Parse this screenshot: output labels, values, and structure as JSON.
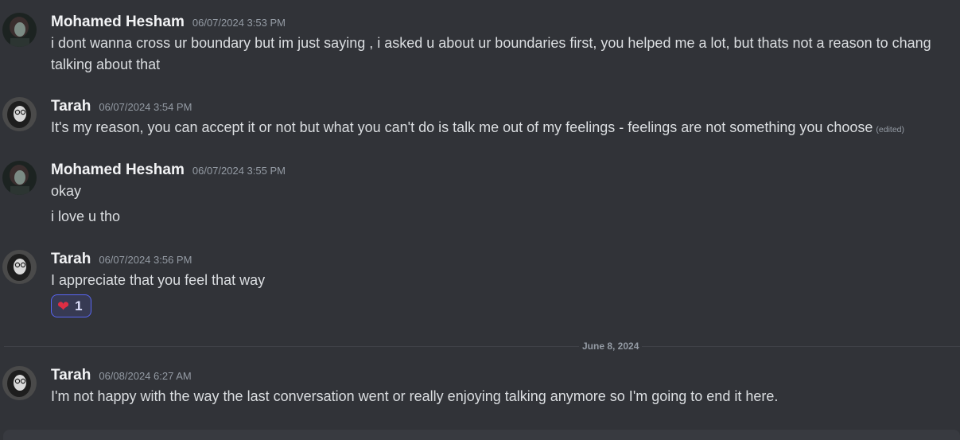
{
  "messages": [
    {
      "author": "Mohamed Hesham",
      "timestamp": "06/07/2024 3:53 PM",
      "lines": [
        "i dont wanna cross ur boundary but im just saying , i asked u about ur boundaries first, you helped me a lot, but thats not a reason to chang",
        "talking about that"
      ]
    },
    {
      "author": "Tarah",
      "timestamp": "06/07/2024 3:54 PM",
      "lines": [
        "It's my reason, you can accept it or not but what you can't do is talk me out of my feelings - feelings are not something you choose"
      ],
      "edited": "(edited)"
    },
    {
      "author": "Mohamed Hesham",
      "timestamp": "06/07/2024 3:55 PM",
      "lines": [
        "okay",
        "i love u tho"
      ]
    },
    {
      "author": "Tarah",
      "timestamp": "06/07/2024 3:56 PM",
      "lines": [
        "I appreciate that you feel that way"
      ],
      "reaction": {
        "emoji": "❤",
        "count": "1"
      }
    },
    {
      "author": "Tarah",
      "timestamp": "06/08/2024 6:27 AM",
      "lines": [
        "I'm not happy with the way the last conversation went or really enjoying talking anymore so I'm going to end it here."
      ]
    }
  ],
  "date_divider": "June 8, 2024",
  "colors": {
    "background": "#313338",
    "username": "#f2f3f5",
    "timestamp": "#949ba4",
    "reaction_border": "#5865f2"
  },
  "icons": {
    "avatar_mohamed": "dark-portrait-avatar",
    "avatar_tarah": "glasses-portrait-avatar",
    "reaction": "red-heart-emoji"
  }
}
